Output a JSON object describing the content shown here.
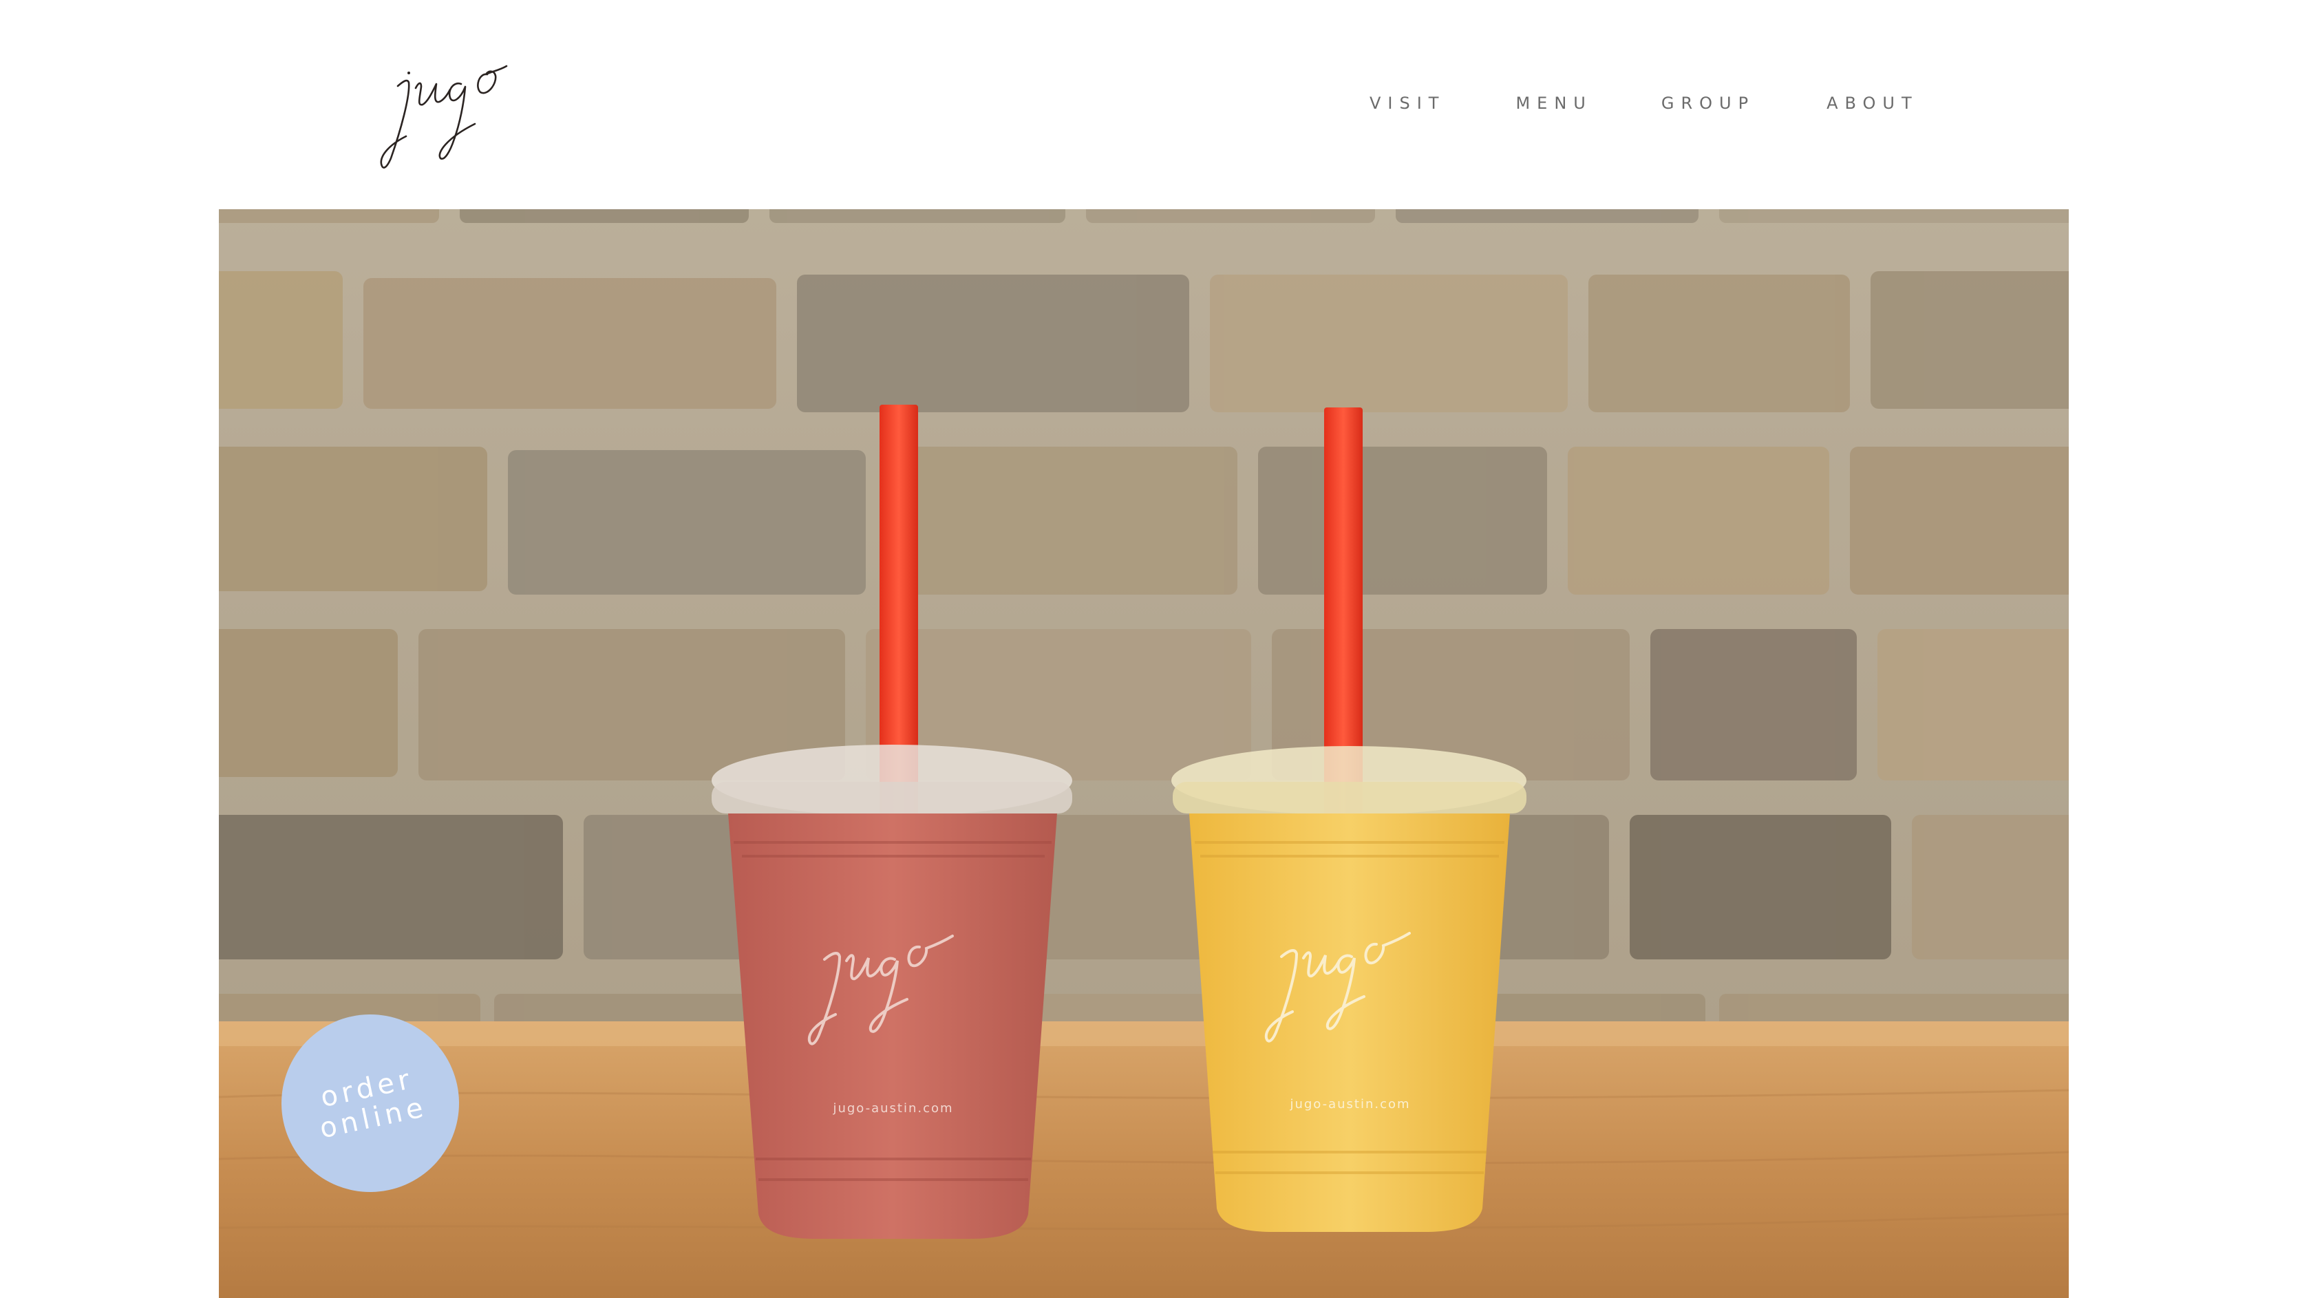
{
  "brand": {
    "logo_text": "jugo",
    "logo_color": "#2b2422"
  },
  "nav": {
    "items": [
      {
        "label": "VISIT"
      },
      {
        "label": "MENU"
      },
      {
        "label": "GROUP"
      },
      {
        "label": "ABOUT"
      }
    ],
    "text_color": "#6b6b6b"
  },
  "hero": {
    "cups": [
      {
        "logo": "jugo",
        "url": "jugo-austin.com",
        "color": "#c96a5e"
      },
      {
        "logo": "jugo",
        "url": "jugo-austin.com",
        "color": "#f3c85a"
      }
    ],
    "straw_color": "#e63a24"
  },
  "cta": {
    "line1": "order",
    "line2": "online",
    "background": "#b9cdec"
  }
}
